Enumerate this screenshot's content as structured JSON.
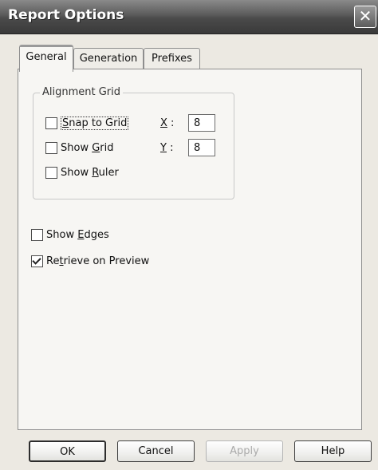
{
  "window": {
    "title": "Report Options",
    "close_glyph": "✕"
  },
  "tabs": [
    {
      "label": "General",
      "active": true
    },
    {
      "label": "Generation",
      "active": false
    },
    {
      "label": "Prefixes",
      "active": false
    }
  ],
  "alignment_grid": {
    "label": "Alignment Grid",
    "snap_to_grid": {
      "pre": "",
      "key": "S",
      "post": "nap to Grid",
      "checked": false
    },
    "show_grid": {
      "pre": "Show ",
      "key": "G",
      "post": "rid",
      "checked": false
    },
    "show_ruler": {
      "pre": "Show ",
      "key": "R",
      "post": "uler",
      "checked": false
    },
    "x_key": "X",
    "x_sep": " :",
    "x_value": "8",
    "y_key": "Y",
    "y_sep": " :",
    "y_value": "8"
  },
  "show_edges": {
    "pre": "Show ",
    "key": "E",
    "post": "dges",
    "checked": false
  },
  "retrieve_on_preview": {
    "pre": "Re",
    "key": "t",
    "post": "rieve on Preview",
    "checked": true
  },
  "buttons": {
    "ok": "OK",
    "cancel": "Cancel",
    "apply": "Apply",
    "help": "Help"
  }
}
